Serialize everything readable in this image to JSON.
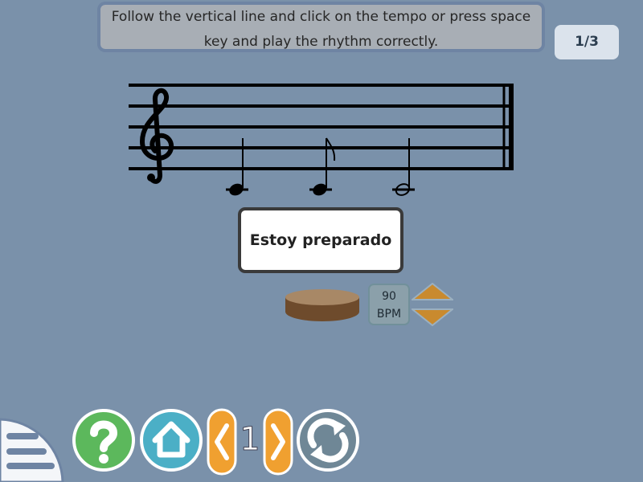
{
  "instruction": {
    "text": "Follow the vertical line and click on the tempo or press space key and play the rhythm correctly."
  },
  "progress": {
    "label": "1/3"
  },
  "exercise": {
    "ready_label": "Estoy preparado",
    "notes": [
      "quarter",
      "eighth",
      "half"
    ]
  },
  "tempo": {
    "value": "90",
    "unit": "BPM"
  },
  "nav": {
    "page_number": "1"
  },
  "colors": {
    "background": "#7a91aa",
    "help_green": "#5cb85c",
    "home_teal": "#4bafc6",
    "nav_orange": "#f0a030",
    "refresh_gray": "#6f8796",
    "arrow_orange": "#c98a2e"
  },
  "icons": {
    "help": "question-mark-icon",
    "home": "house-icon",
    "prev": "chevron-left-icon",
    "next": "chevron-right-icon",
    "refresh": "refresh-icon",
    "menu": "hamburger-icon",
    "drum": "drum-icon",
    "clef": "treble-clef-icon"
  }
}
